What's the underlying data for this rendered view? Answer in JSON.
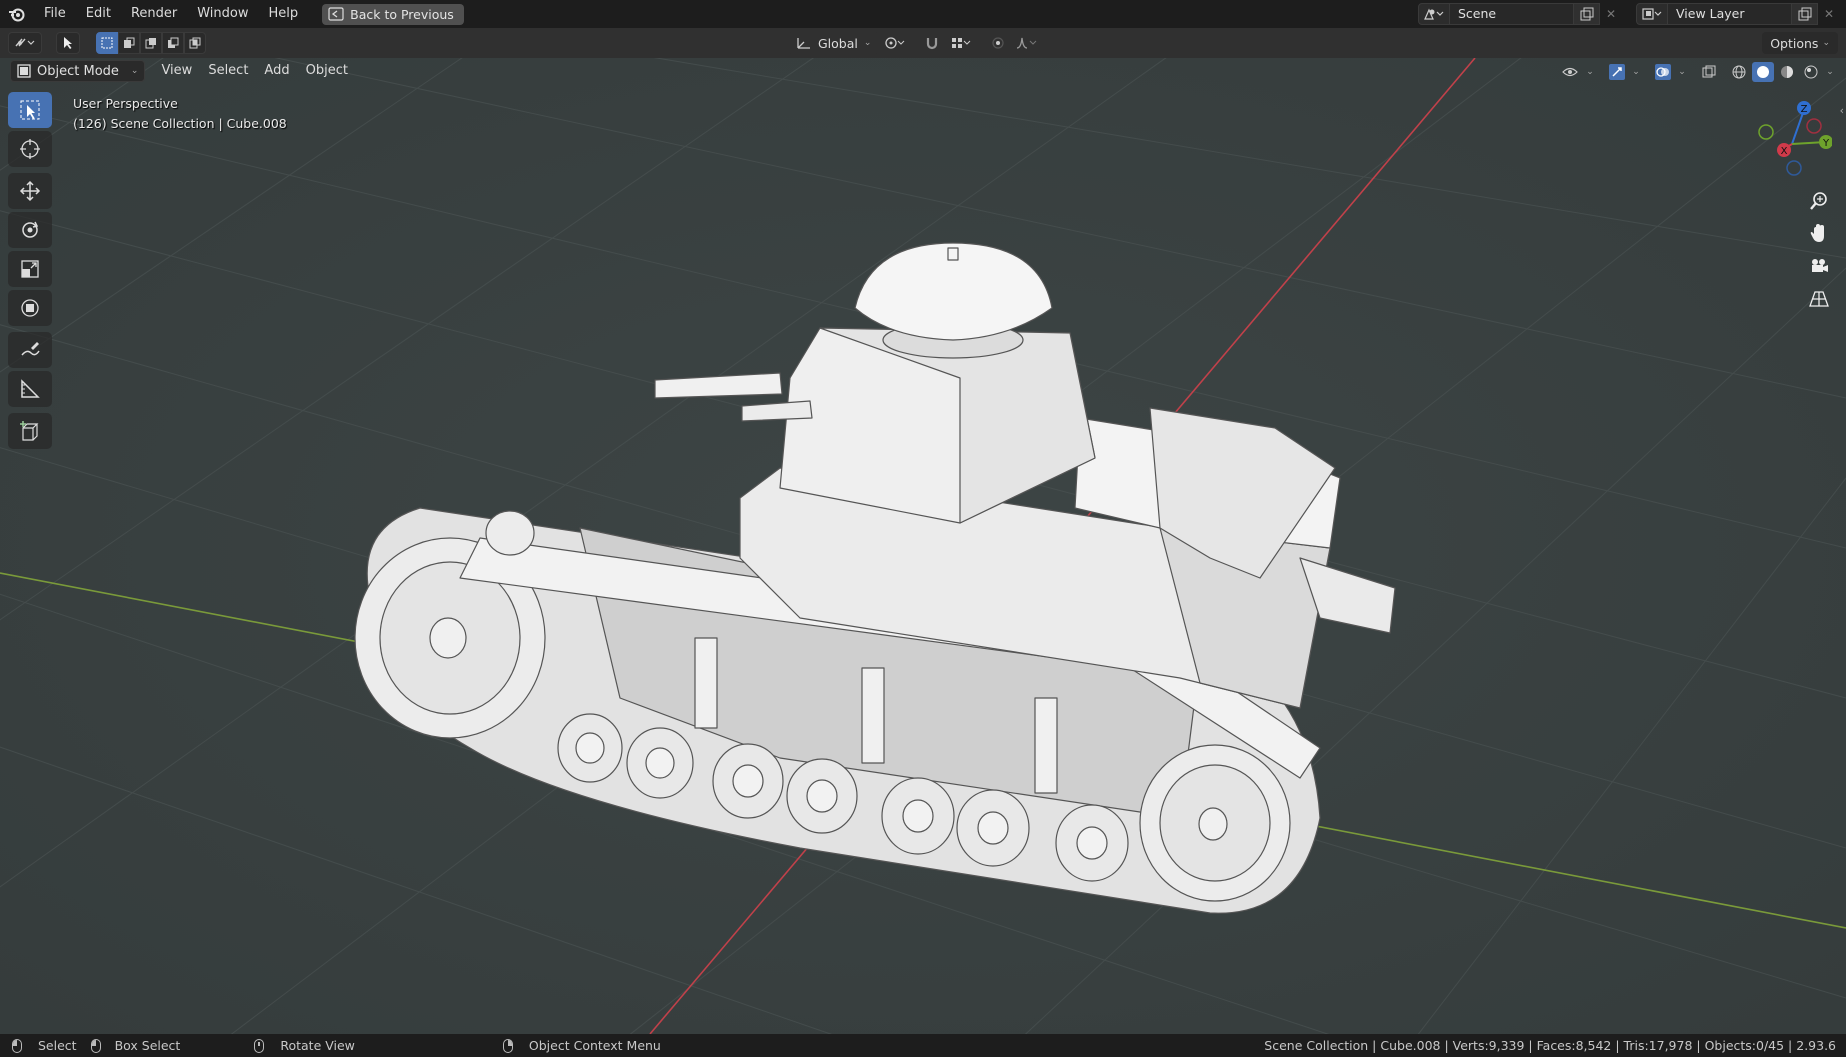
{
  "topbar": {
    "menus": [
      "File",
      "Edit",
      "Render",
      "Window",
      "Help"
    ],
    "back_button": "Back to Previous",
    "scene": "Scene",
    "view_layer": "View Layer"
  },
  "toolheader": {
    "orientation": "Global",
    "options": "Options"
  },
  "viewport_header": {
    "mode": "Object Mode",
    "menus": [
      "View",
      "Select",
      "Add",
      "Object"
    ]
  },
  "viewport_info": {
    "line1": "User Perspective",
    "line2": "(126) Scene Collection | Cube.008"
  },
  "tools": [
    "select-box",
    "cursor",
    "move",
    "rotate",
    "scale",
    "transform",
    "annotate",
    "measure",
    "add-cube"
  ],
  "gizmo": {
    "z": "Z",
    "y": "Y",
    "x": "X"
  },
  "statusbar": {
    "select": "Select",
    "box_select": "Box Select",
    "rotate_view": "Rotate View",
    "context_menu": "Object Context Menu",
    "stats": "Scene Collection | Cube.008 | Verts:9,339 | Faces:8,542 | Tris:17,978 | Objects:0/45 | 2.93.6"
  },
  "colors": {
    "viewport_bg": "#3a4141",
    "axis_x": "#c0414a",
    "axis_y": "#7a9a3a",
    "active_blue": "#4772b3"
  }
}
